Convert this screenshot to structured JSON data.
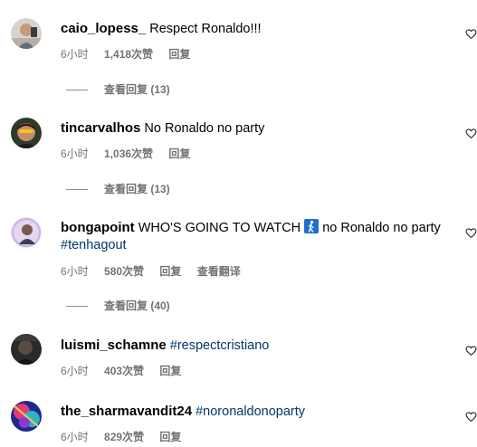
{
  "comments": [
    {
      "username": "caio_lopess_",
      "text": "Respect Ronaldo!!!",
      "time": "6小时",
      "likes": "1,418次赞",
      "reply": "回复",
      "view_replies": "查看回复 (13)"
    },
    {
      "username": "tincarvalhos",
      "text": "No Ronaldo no party",
      "time": "6小时",
      "likes": "1,036次赞",
      "reply": "回复",
      "view_replies": "查看回复 (13)"
    },
    {
      "username": "bongapoint",
      "text_before_emoji": "WHO'S GOING TO WATCH",
      "emoji_icon": "person-walking-icon",
      "text_after_emoji": "no Ronaldo no party",
      "hashtag": "#tenhagout",
      "time": "6小时",
      "likes": "580次赞",
      "reply": "回复",
      "translate": "查看翻译",
      "view_replies": "查看回复 (40)"
    },
    {
      "username": "luismi_schamne",
      "hashtag": "#respectcristiano",
      "time": "6小时",
      "likes": "403次赞",
      "reply": "回复"
    },
    {
      "username": "the_sharmavandit24",
      "hashtag": "#noronaldonoparty",
      "time": "6小时",
      "likes": "829次赞",
      "reply": "回复"
    }
  ],
  "colors": {
    "meta_text": "#737373",
    "hashtag": "#00376b"
  },
  "icons": {
    "like": "heart-icon"
  }
}
